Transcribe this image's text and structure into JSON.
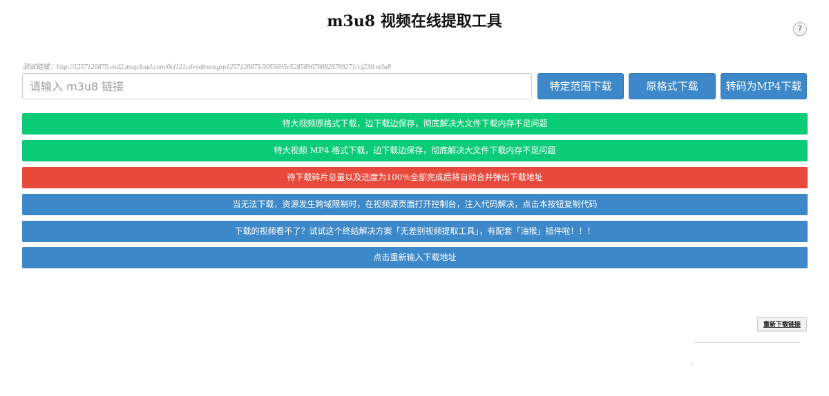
{
  "header": {
    "title": "m3u8 视频在线提取工具",
    "help_label": "?"
  },
  "test_link": "测试链接：http://1257120875.vod2.myqcloud.com/0ef121cdvodtransgzp1257120875/3055695e5285890780828799271/v.f230.m3u8",
  "url_input": {
    "value": "",
    "placeholder": "请输入 m3u8 链接"
  },
  "buttons": {
    "range_download": "特定范围下载",
    "original_download": "原格式下载",
    "mp4_download": "转码为MP4下载"
  },
  "bars": {
    "stream_original": "特大视频原格式下载，边下载边保存，彻底解决大文件下载内存不足问题",
    "stream_mp4": "特大视频 MP4 格式下载，边下载边保存，彻底解决大文件下载内存不足问题",
    "progress_notice": "待下载碎片总量以及进度为100%全部完成后将自动合并弹出下载地址",
    "cors_copy_code": "当无法下载，资源发生跨域限制时，在视频源页面打开控制台，注入代码解决，点击本按钮复制代码",
    "alt_tool": "下载的视频看不了？试试这个终结解决方案「无差别视频提取工具」，有配套「油猴」插件啦！！！",
    "reenter": "点击重新输入下载地址"
  },
  "redownload_label": "重新下载链接",
  "colors": {
    "green": "#0bcc76",
    "red": "#e74a3c",
    "blue": "#3d88c8"
  }
}
